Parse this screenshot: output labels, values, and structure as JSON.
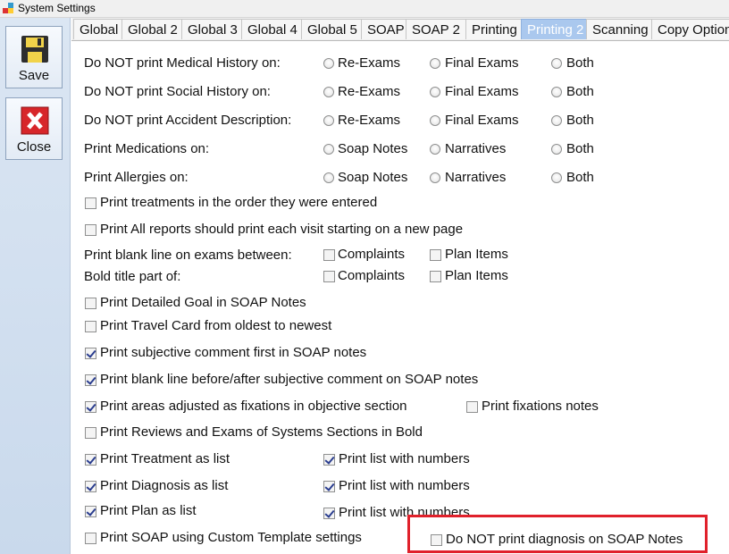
{
  "window": {
    "title": "System Settings"
  },
  "toolbar": {
    "save_label": "Save",
    "close_label": "Close"
  },
  "tabs": [
    "Global",
    "Global 2",
    "Global 3",
    "Global 4",
    "Global 5",
    "SOAP",
    "SOAP 2",
    "Printing",
    "Printing 2",
    "Scanning",
    "Copy Option"
  ],
  "active_tab": "Printing 2",
  "radio_rows": [
    {
      "label": "Do NOT print Medical History on:",
      "options": [
        "Re-Exams",
        "Final Exams",
        "Both"
      ]
    },
    {
      "label": "Do NOT print Social History on:",
      "options": [
        "Re-Exams",
        "Final Exams",
        "Both"
      ]
    },
    {
      "label": "Do NOT print Accident Description:",
      "options": [
        "Re-Exams",
        "Final Exams",
        "Both"
      ]
    },
    {
      "label": "Print Medications on:",
      "options": [
        "Soap Notes",
        "Narratives",
        "Both"
      ]
    },
    {
      "label": "Print Allergies on:",
      "options": [
        "Soap Notes",
        "Narratives",
        "Both"
      ]
    }
  ],
  "checks": {
    "treatments_order": {
      "label": "Print treatments in the order they were entered",
      "checked": false
    },
    "new_page": {
      "label": "Print All reports should print each visit starting on a new page",
      "checked": false
    },
    "blank_line_label": "Print blank line on exams between:",
    "blank_complaints": {
      "label": "Complaints",
      "checked": false
    },
    "blank_plan": {
      "label": "Plan Items",
      "checked": false
    },
    "bold_label": "Bold title part of:",
    "bold_complaints": {
      "label": "Complaints",
      "checked": false
    },
    "bold_plan": {
      "label": "Plan Items",
      "checked": false
    },
    "detailed_goal": {
      "label": "Print Detailed Goal in SOAP Notes",
      "checked": false
    },
    "travel_card": {
      "label": "Print Travel Card from oldest to newest",
      "checked": false
    },
    "subjective_first": {
      "label": "Print subjective comment first in SOAP notes",
      "checked": true
    },
    "blank_subjective": {
      "label": "Print blank line before/after subjective comment on SOAP notes",
      "checked": true
    },
    "areas_fixations": {
      "label": "Print areas adjusted as fixations in objective section",
      "checked": true
    },
    "fixations_notes": {
      "label": "Print fixations notes",
      "checked": false
    },
    "reviews_bold": {
      "label": "Print Reviews and Exams of Systems Sections in Bold",
      "checked": false
    },
    "treatment_list": {
      "label": "Print Treatment as list",
      "checked": true
    },
    "treatment_numbers": {
      "label": "Print list with numbers",
      "checked": true
    },
    "diagnosis_list": {
      "label": "Print Diagnosis as list",
      "checked": true
    },
    "diagnosis_numbers": {
      "label": "Print list with numbers",
      "checked": true
    },
    "plan_list": {
      "label": "Print Plan as list",
      "checked": true
    },
    "plan_numbers": {
      "label": "Print list with numbers",
      "checked": true
    },
    "custom_template": {
      "label": "Print SOAP using Custom Template settings",
      "checked": false
    },
    "no_diagnosis": {
      "label": "Do NOT print diagnosis on SOAP Notes",
      "checked": false
    }
  },
  "colors": {
    "active_tab": "#aac8ee",
    "highlight": "#e0212b",
    "check": "#2a3d8f"
  }
}
